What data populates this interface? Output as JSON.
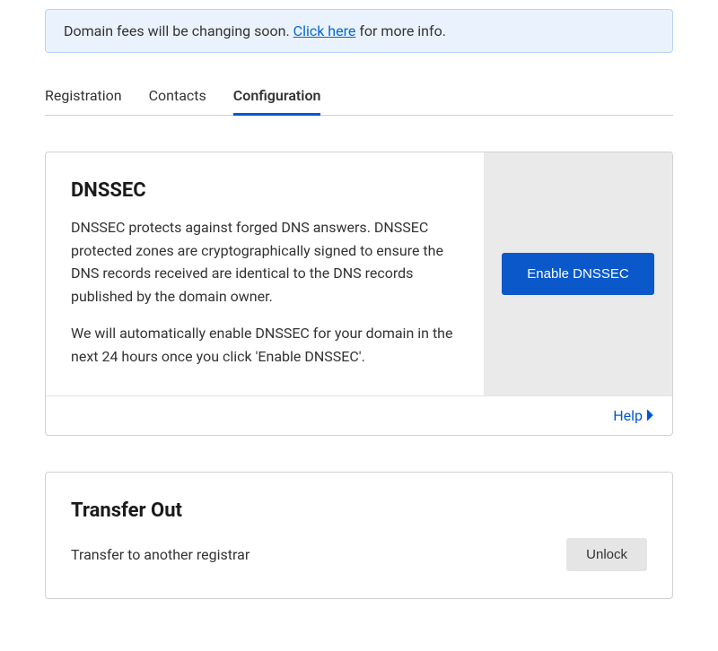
{
  "notice": {
    "prefix": "Domain fees will be changing soon. ",
    "link_text": "Click here",
    "suffix": " for more info."
  },
  "tabs": {
    "registration": "Registration",
    "contacts": "Contacts",
    "configuration": "Configuration"
  },
  "dnssec": {
    "title": "DNSSEC",
    "para1": "DNSSEC protects against forged DNS answers. DNSSEC protected zones are cryptographically signed to ensure the DNS records received are identical to the DNS records published by the domain owner.",
    "para2": "We will automatically enable DNSSEC for your domain in the next 24 hours once you click 'Enable DNSSEC'.",
    "button": "Enable DNSSEC",
    "help": "Help"
  },
  "transfer": {
    "title": "Transfer Out",
    "subtitle": "Transfer to another registrar",
    "button": "Unlock"
  }
}
